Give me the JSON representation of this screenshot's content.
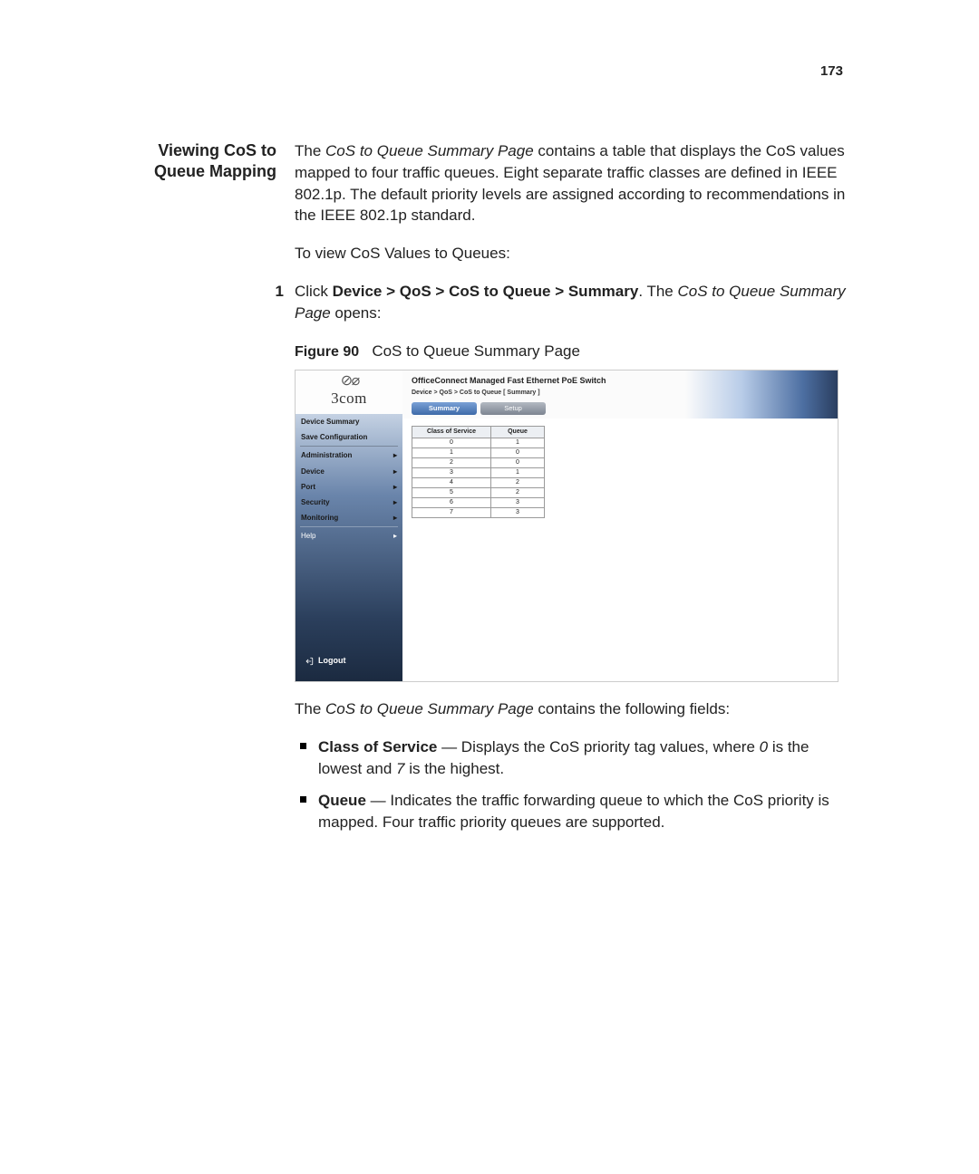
{
  "page_number": "173",
  "section_heading_l1": "Viewing CoS to",
  "section_heading_l2": "Queue Mapping",
  "intro_p1_a": "The ",
  "intro_p1_em": "CoS to Queue Summary Page",
  "intro_p1_b": " contains a table that displays the CoS values mapped to four traffic queues. Eight separate traffic classes are defined in IEEE 802.1p. The default priority levels are assigned according to recommendations in the IEEE 802.1p standard.",
  "intro_p2": "To view CoS Values to Queues:",
  "step1_num": "1",
  "step1_a": "Click ",
  "step1_bold": "Device > QoS > CoS to Queue > Summary",
  "step1_b": ". The ",
  "step1_em": "CoS to Queue Summary Page",
  "step1_c": " opens:",
  "figure_label_bold": "Figure 90",
  "figure_label_rest": "CoS to Queue Summary Page",
  "shot": {
    "brand_name": "3com",
    "header_title": "OfficeConnect Managed Fast Ethernet PoE Switch",
    "breadcrumb": "Device > QoS > CoS to Queue [ Summary ]",
    "tabs": {
      "summary": "Summary",
      "setup": "Setup"
    },
    "sidebar": {
      "device_summary": "Device Summary",
      "save_config": "Save Configuration",
      "administration": "Administration",
      "device": "Device",
      "port": "Port",
      "security": "Security",
      "monitoring": "Monitoring",
      "help": "Help",
      "logout": "Logout"
    },
    "table": {
      "col1": "Class of Service",
      "col2": "Queue",
      "rows": [
        {
          "cos": "0",
          "q": "1"
        },
        {
          "cos": "1",
          "q": "0"
        },
        {
          "cos": "2",
          "q": "0"
        },
        {
          "cos": "3",
          "q": "1"
        },
        {
          "cos": "4",
          "q": "2"
        },
        {
          "cos": "5",
          "q": "2"
        },
        {
          "cos": "6",
          "q": "3"
        },
        {
          "cos": "7",
          "q": "3"
        }
      ]
    }
  },
  "after_p_a": "The ",
  "after_p_em": "CoS to Queue Summary Page",
  "after_p_b": " contains the following fields:",
  "bullets": [
    {
      "bold": "Class of Service",
      "a": " — Displays the CoS priority tag values, where ",
      "em1": "0",
      "b": " is the lowest and ",
      "em2": "7",
      "c": " is the highest."
    },
    {
      "bold": "Queue",
      "a": " — Indicates the traffic forwarding queue to which the CoS priority is mapped. Four traffic priority queues are supported."
    }
  ]
}
